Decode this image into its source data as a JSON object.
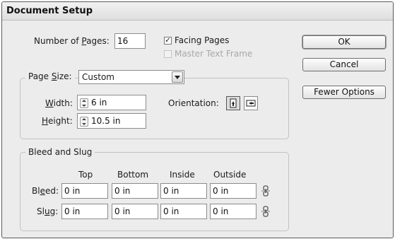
{
  "window": {
    "title": "Document Setup"
  },
  "pages": {
    "label": "Number of Pages:",
    "value": "16"
  },
  "facing_pages": {
    "label": "Facing Pages",
    "checked": true
  },
  "master_text_frame": {
    "label": "Master Text Frame",
    "checked": false,
    "enabled": false
  },
  "page_size": {
    "label": "Page Size:",
    "selected": "Custom",
    "width_label": "Width:",
    "width_value": "6 in",
    "height_label": "Height:",
    "height_value": "10.5 in",
    "orientation_label": "Orientation:",
    "orientation_icons": [
      "portrait-icon",
      "landscape-icon"
    ]
  },
  "bleed_slug": {
    "title": "Bleed and Slug",
    "columns": [
      "Top",
      "Bottom",
      "Inside",
      "Outside"
    ],
    "bleed_label": "Bleed:",
    "bleed_values": [
      "0 in",
      "0 in",
      "0 in",
      "0 in"
    ],
    "slug_label": "Slug:",
    "slug_values": [
      "0 in",
      "0 in",
      "0 in",
      "0 in"
    ],
    "link_icon": "chain-link-icon"
  },
  "buttons": {
    "ok": "OK",
    "cancel": "Cancel",
    "fewer": "Fewer Options"
  }
}
